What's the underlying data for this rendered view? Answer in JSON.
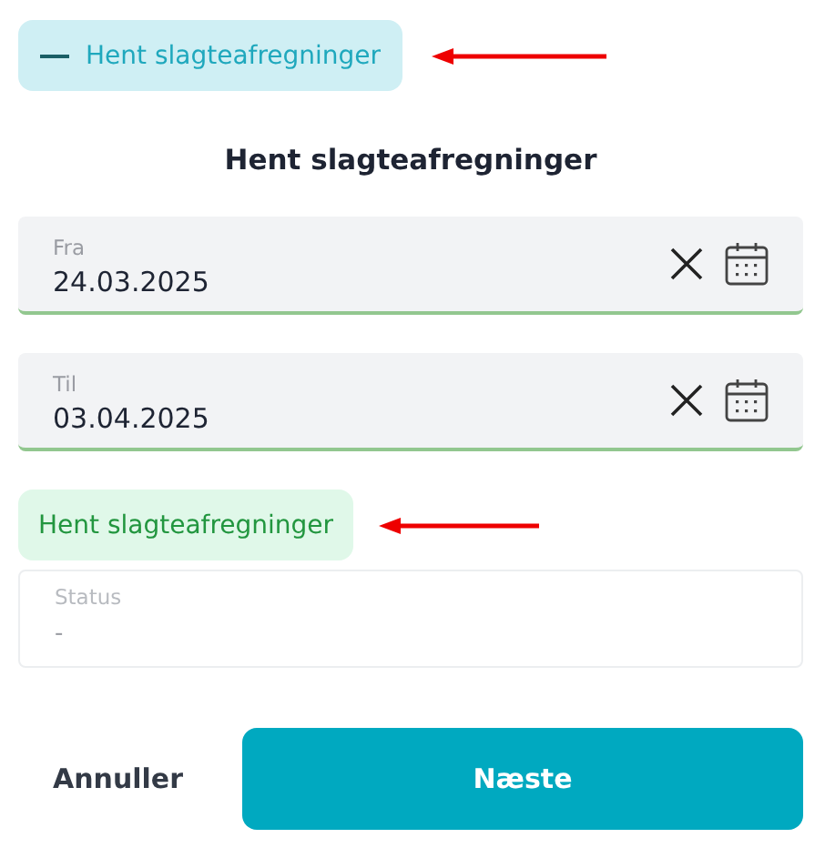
{
  "toggle": {
    "label": "Hent slagteafregninger",
    "expanded": true
  },
  "title": "Hent slagteafregninger",
  "date_fields": [
    {
      "label": "Fra",
      "value": "24.03.2025"
    },
    {
      "label": "Til",
      "value": "03.04.2025"
    }
  ],
  "fetch_button": "Hent slagteafregninger",
  "status": {
    "label": "Status",
    "value": "-"
  },
  "buttons": {
    "cancel": "Annuller",
    "next": "Næste"
  }
}
